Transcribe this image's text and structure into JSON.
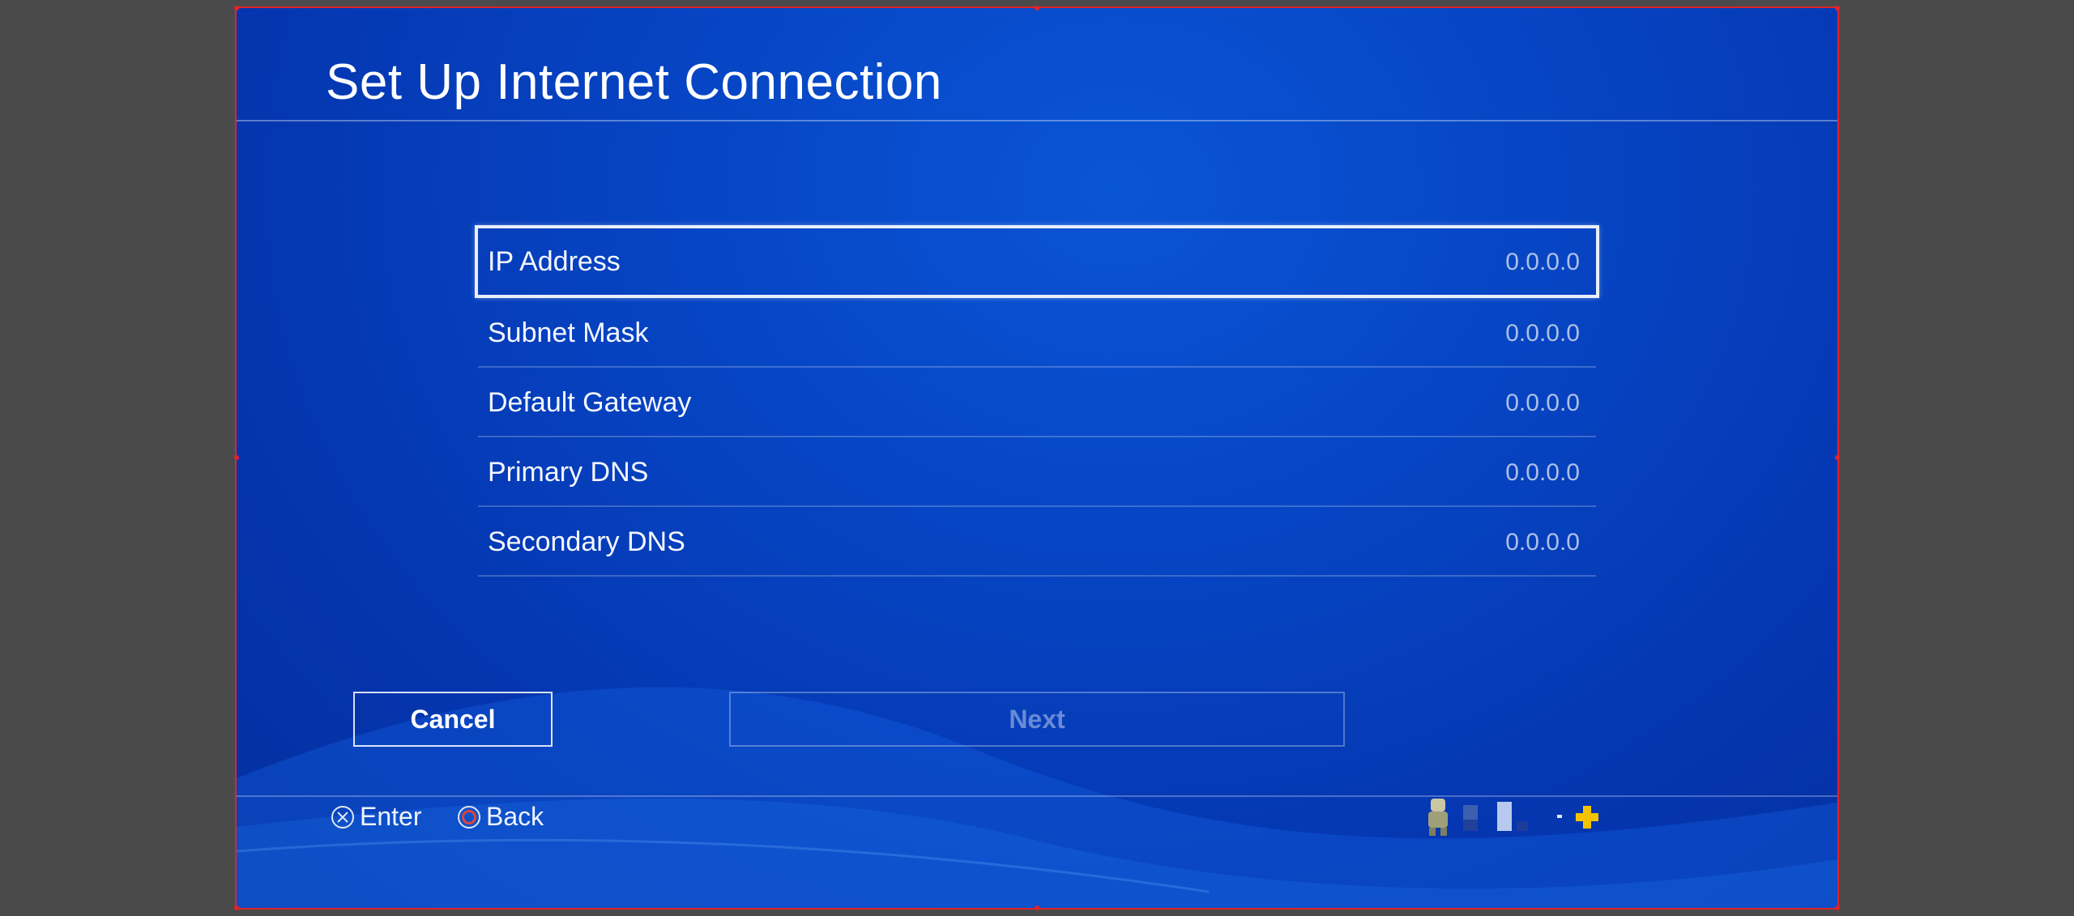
{
  "screen": {
    "title": "Set Up Internet Connection"
  },
  "settings": [
    {
      "label": "IP Address",
      "value": "0.0.0.0",
      "selected": true
    },
    {
      "label": "Subnet Mask",
      "value": "0.0.0.0",
      "selected": false
    },
    {
      "label": "Default Gateway",
      "value": "0.0.0.0",
      "selected": false
    },
    {
      "label": "Primary DNS",
      "value": "0.0.0.0",
      "selected": false
    },
    {
      "label": "Secondary DNS",
      "value": "0.0.0.0",
      "selected": false
    }
  ],
  "buttons": {
    "cancel": "Cancel",
    "next": "Next"
  },
  "hints": {
    "enter": {
      "icon": "cross-button-icon",
      "label": "Enter"
    },
    "back": {
      "icon": "circle-button-icon",
      "label": "Back"
    }
  },
  "status_icons": [
    "avatar-icon",
    "wifi-signal-icon",
    "battery-icon",
    "playstation-plus-icon"
  ],
  "colors": {
    "background": "#0645c4",
    "accent": "#f4c300",
    "selection_border": "#e9eef8",
    "circle_button": "#e0443a"
  }
}
